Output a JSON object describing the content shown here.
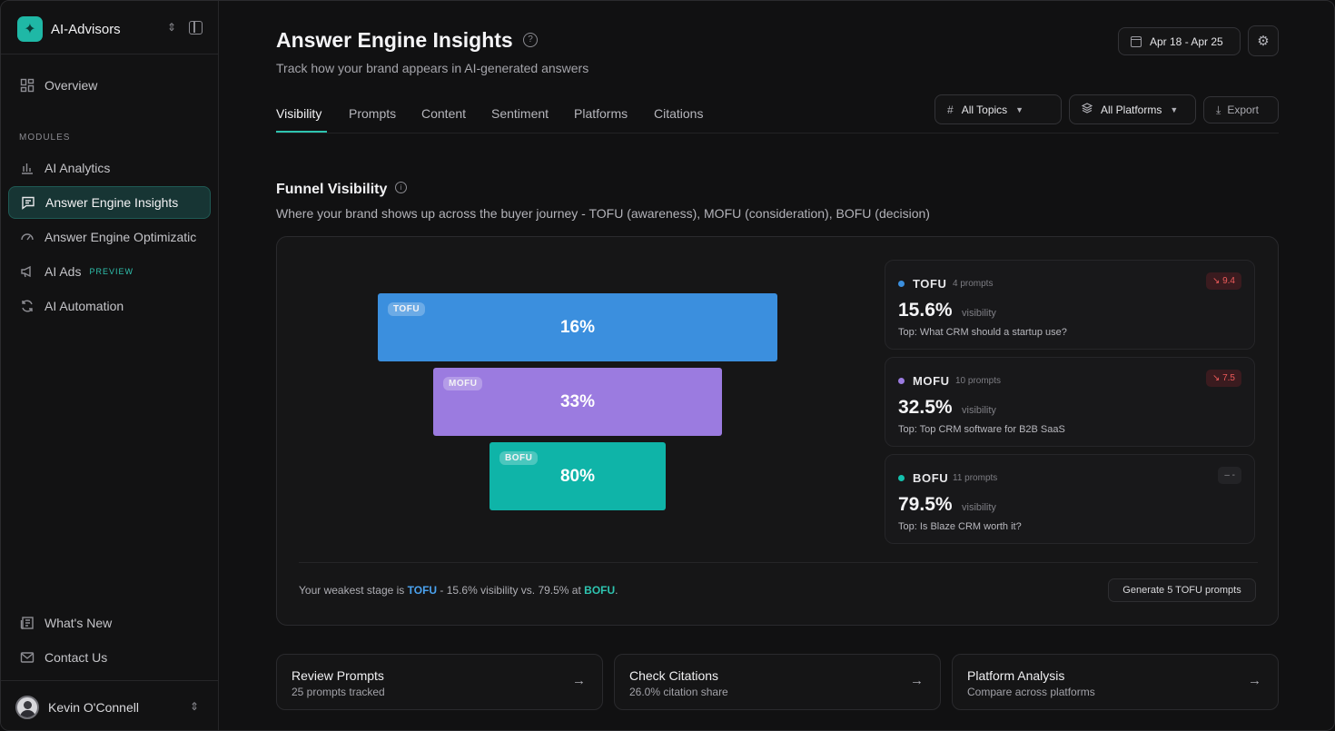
{
  "app": {
    "name": "AI-Advisors",
    "logo_glyph": "✦"
  },
  "sidebar": {
    "overview": "Overview",
    "modules_label": "MODULES",
    "items": [
      {
        "label": "AI Analytics",
        "icon": "bar-chart-icon"
      },
      {
        "label": "Answer Engine Insights",
        "icon": "message-square-icon",
        "active": true
      },
      {
        "label": "Answer Engine Optimizatic",
        "icon": "gauge-icon"
      },
      {
        "label": "AI Ads",
        "icon": "megaphone-icon",
        "badge": "PREVIEW"
      },
      {
        "label": "AI Automation",
        "icon": "refresh-icon"
      }
    ],
    "whats_new": "What's New",
    "contact": "Contact Us",
    "user_name": "Kevin O'Connell"
  },
  "header": {
    "title": "Answer Engine Insights",
    "subtitle": "Track how your brand appears in AI-generated answers",
    "date_range": "Apr 18 - Apr 25"
  },
  "tabs": [
    "Visibility",
    "Prompts",
    "Content",
    "Sentiment",
    "Platforms",
    "Citations"
  ],
  "filters": {
    "topics": "All Topics",
    "platforms": "All Platforms",
    "export": "Export"
  },
  "funnel": {
    "title": "Funnel Visibility",
    "subtitle": "Where your brand shows up across the buyer journey - TOFU (awareness), MOFU (consideration), BOFU (decision)",
    "bars": [
      {
        "tag": "TOFU",
        "label": "16%",
        "color": "#3b8fde"
      },
      {
        "tag": "MOFU",
        "label": "33%",
        "color": "#9b7be0"
      },
      {
        "tag": "BOFU",
        "label": "80%",
        "color": "#0fb4a8"
      }
    ],
    "stages": [
      {
        "name": "TOFU",
        "count": "4 prompts",
        "delta": "↘ 9.4",
        "value": "15.6%",
        "value_label": "visibility",
        "top": "Top: What CRM should a startup use?",
        "color": "#3b8fde"
      },
      {
        "name": "MOFU",
        "count": "10 prompts",
        "delta": "↘ 7.5",
        "value": "32.5%",
        "value_label": "visibility",
        "top": "Top: Top CRM software for B2B SaaS",
        "color": "#9b7be0"
      },
      {
        "name": "BOFU",
        "count": "11 prompts",
        "delta": "– -",
        "value": "79.5%",
        "value_label": "visibility",
        "top": "Top: Is Blaze CRM worth it?",
        "color": "#13c0ad"
      }
    ],
    "footer": {
      "prefix": "Your weakest stage is ",
      "weak": "TOFU",
      "middle": " - 15.6% visibility vs. 79.5% at ",
      "strong": "BOFU",
      "suffix": "."
    },
    "generate_button": "Generate 5 TOFU prompts"
  },
  "quick_links": [
    {
      "title": "Review Prompts",
      "sub": "25 prompts tracked"
    },
    {
      "title": "Check Citations",
      "sub": "26.0% citation share"
    },
    {
      "title": "Platform Analysis",
      "sub": "Compare across platforms"
    }
  ]
}
